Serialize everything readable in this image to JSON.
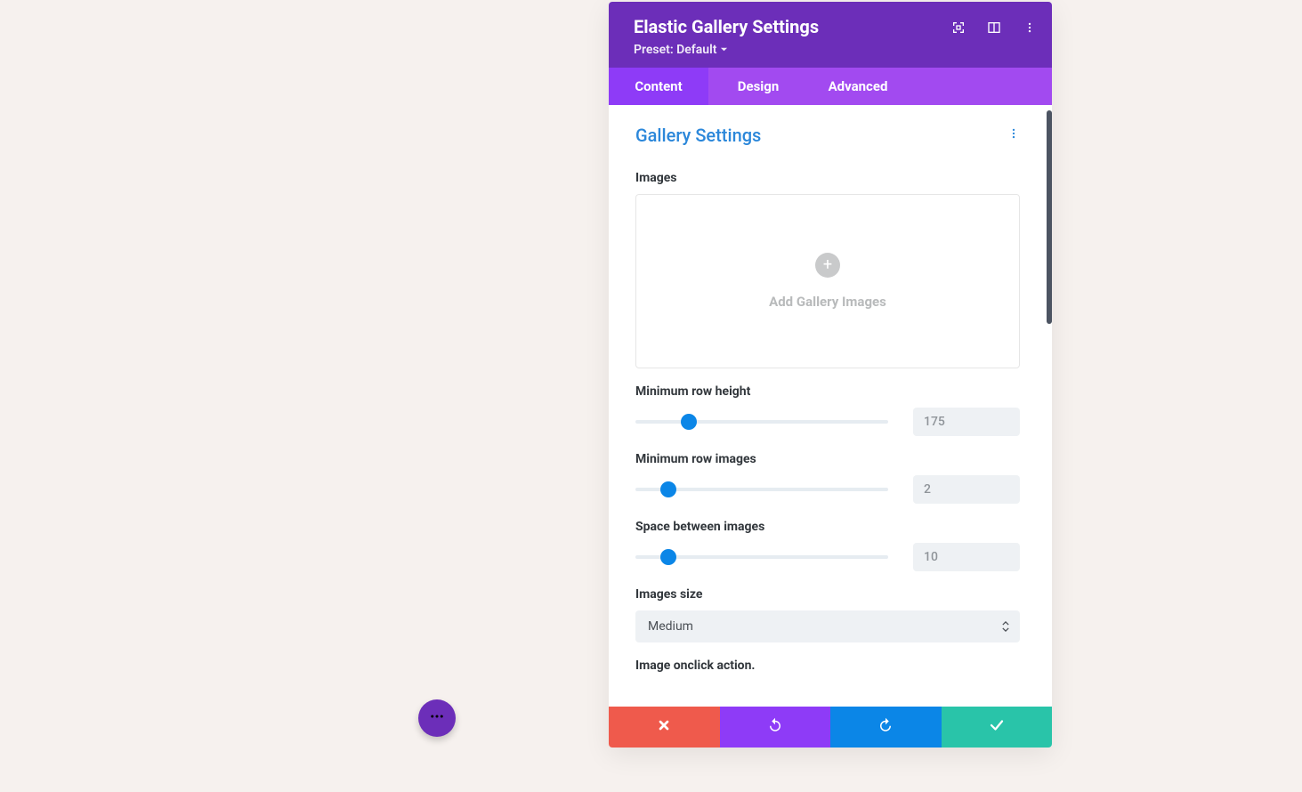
{
  "header": {
    "title": "Elastic Gallery Settings",
    "preset_label": "Preset: Default"
  },
  "tabs": [
    "Content",
    "Design",
    "Advanced"
  ],
  "active_tab": 0,
  "section_title": "Gallery Settings",
  "images": {
    "label": "Images",
    "add_label": "Add Gallery Images"
  },
  "sliders": [
    {
      "label": "Minimum row height",
      "value": "175",
      "pos_pct": 21
    },
    {
      "label": "Minimum row images",
      "value": "2",
      "pos_pct": 13
    },
    {
      "label": "Space between images",
      "value": "10",
      "pos_pct": 13
    }
  ],
  "images_size": {
    "label": "Images size",
    "value": "Medium"
  },
  "onclick_label": "Image onclick action.",
  "colors": {
    "accent": "#0b86e7"
  }
}
